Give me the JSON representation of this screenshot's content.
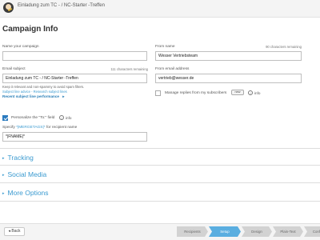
{
  "header": {
    "title": "Einladung zum TC - / NC-Starter -Treffen"
  },
  "section_title": "Campaign Info",
  "campaign_name": {
    "label": "Name your campaign",
    "value": ""
  },
  "from_name": {
    "label": "From name",
    "counter": "90 characters remaining",
    "value": "Wesser Vertriebsteam"
  },
  "email_subject": {
    "label": "Email subject",
    "counter": "111 characters remaining",
    "value": "Einladung zum TC - / NC-Starter -Treffen",
    "hint": "Keep it relevant and non-spammy to avoid spam filters.",
    "advice_link": "Subject line advice - Research subject lines",
    "performance_link": "Recent subject line performance",
    "performance_arrow": "▸"
  },
  "from_email": {
    "label": "From email address",
    "value": "vertrieb@wesser.de"
  },
  "manage_replies": {
    "label": "Manage replies from my subscribers",
    "badge": "new",
    "info": "info",
    "checked": false
  },
  "personalize": {
    "label": "Personalize the \"To:\" field",
    "info": "info",
    "checked": true
  },
  "merge_tag": {
    "label_prefix": "Specify",
    "label_link": "*|MERGETAGS|*",
    "label_suffix": "for recipient name",
    "value": "*|FNAME|*"
  },
  "collapsibles": [
    {
      "label": "Tracking",
      "arrow": "▸"
    },
    {
      "label": "Social Media",
      "arrow": "▸"
    },
    {
      "label": "More Options",
      "arrow": "▸"
    }
  ],
  "footer": {
    "back_label": "◂  Back",
    "steps": [
      {
        "label": "Recipients",
        "active": false
      },
      {
        "label": "Setup",
        "active": true
      },
      {
        "label": "Design",
        "active": false
      },
      {
        "label": "Plain-Text",
        "active": false
      },
      {
        "label": "Confirm",
        "active": false
      }
    ]
  },
  "colors": {
    "accent": "#3a9ad0",
    "active_step": "#5aaee0",
    "checkbox_checked": "#2b7bbf"
  }
}
